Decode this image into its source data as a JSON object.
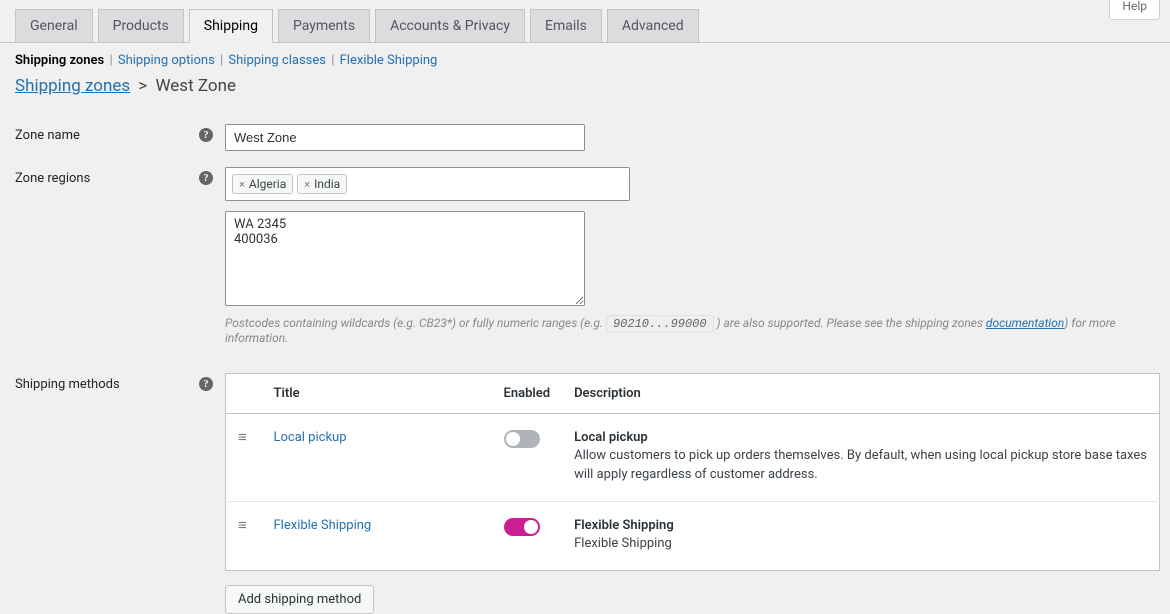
{
  "help_tab": "Help",
  "tabs": [
    {
      "label": "General"
    },
    {
      "label": "Products"
    },
    {
      "label": "Shipping",
      "active": true
    },
    {
      "label": "Payments"
    },
    {
      "label": "Accounts & Privacy"
    },
    {
      "label": "Emails"
    },
    {
      "label": "Advanced"
    }
  ],
  "subtabs": [
    {
      "label": "Shipping zones",
      "current": true
    },
    {
      "label": "Shipping options"
    },
    {
      "label": "Shipping classes"
    },
    {
      "label": "Flexible Shipping"
    }
  ],
  "breadcrumb": {
    "root": "Shipping zones",
    "current": "West Zone"
  },
  "labels": {
    "zone_name": "Zone name",
    "zone_regions": "Zone regions",
    "shipping_methods": "Shipping methods"
  },
  "zone_name_value": "West Zone",
  "zone_regions_tags": [
    "Algeria",
    "India"
  ],
  "postcodes_value": "WA 2345\n400036",
  "postcode_hint": {
    "p1": "Postcodes containing wildcards (e.g. CB23*) or fully numeric ranges (e.g.",
    "mono": "90210...99000",
    "p2": ") are also supported. Please see the shipping zones",
    "link": "documentation",
    "p3": ") for more information."
  },
  "table_headers": {
    "title": "Title",
    "enabled": "Enabled",
    "description": "Description"
  },
  "methods": [
    {
      "title": "Local pickup",
      "enabled": false,
      "desc_title": "Local pickup",
      "desc": "Allow customers to pick up orders themselves. By default, when using local pickup store base taxes will apply regardless of customer address."
    },
    {
      "title": "Flexible Shipping",
      "enabled": true,
      "desc_title": "Flexible Shipping",
      "desc": "Flexible Shipping"
    }
  ],
  "add_method_btn": "Add shipping method"
}
